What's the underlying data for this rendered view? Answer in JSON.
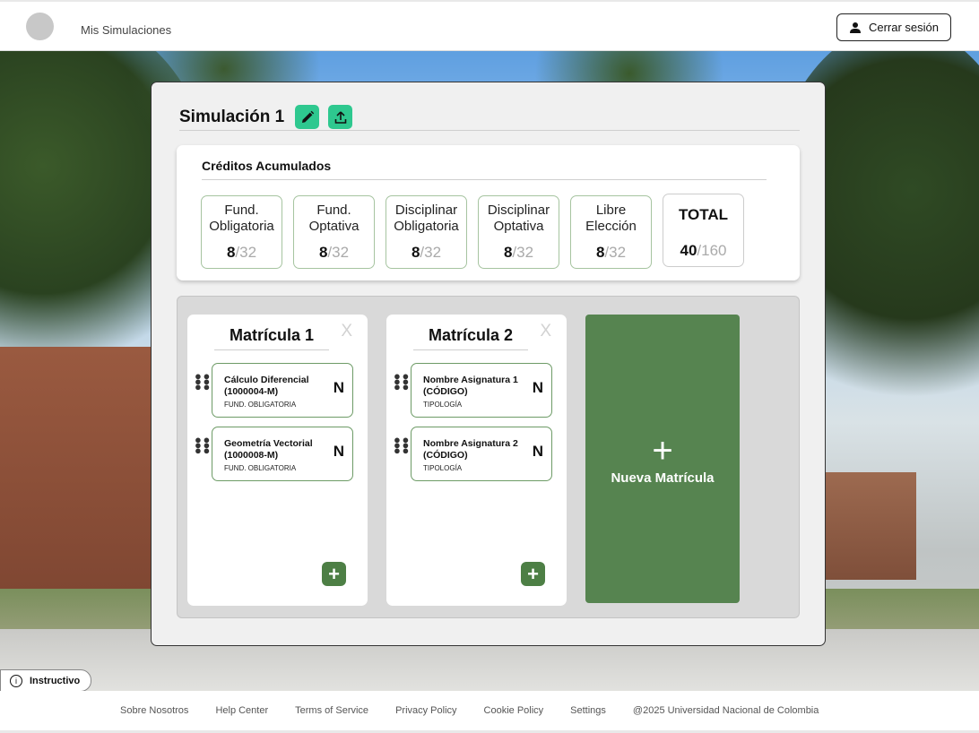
{
  "header": {
    "brand": "Mis Simulaciones",
    "logout_label": "Cerrar sesión"
  },
  "simulation": {
    "title": "Simulación 1"
  },
  "credits": {
    "title": "Créditos Acumulados",
    "cards": [
      {
        "label_line1": "Fund.",
        "label_line2": "Obligatoria",
        "earned": "8",
        "required": "/32"
      },
      {
        "label_line1": "Fund.",
        "label_line2": "Optativa",
        "earned": "8",
        "required": "/32"
      },
      {
        "label_line1": "Disciplinar",
        "label_line2": "Obligatoria",
        "earned": "8",
        "required": "/32"
      },
      {
        "label_line1": "Disciplinar",
        "label_line2": "Optativa",
        "earned": "8",
        "required": "/32"
      },
      {
        "label_line1": "Libre",
        "label_line2": "Elección",
        "earned": "8",
        "required": "/32"
      }
    ],
    "total": {
      "label": "TOTAL",
      "earned": "40",
      "required": "/160"
    }
  },
  "matriculas": [
    {
      "title": "Matrícula 1",
      "close": "X",
      "subjects": [
        {
          "name": "Cálculo Diferencial (1000004-M)",
          "type": "FUND. OBLIGATORIA",
          "grade": "N"
        },
        {
          "name": "Geometría Vectorial (1000008-M)",
          "type": "FUND. OBLIGATORIA",
          "grade": "N"
        }
      ],
      "add": "+"
    },
    {
      "title": "Matrícula 2",
      "close": "X",
      "subjects": [
        {
          "name": "Nombre Asignatura 1 (CÓDIGO)",
          "type": "TIPOLOGÍA",
          "grade": "N"
        },
        {
          "name": "Nombre Asignatura 2 (CÓDIGO)",
          "type": "TIPOLOGÍA",
          "grade": "N"
        }
      ],
      "add": "+"
    }
  ],
  "new_matricula": {
    "plus": "+",
    "label": "Nueva Matrícula"
  },
  "instructivo": {
    "label": "Instructivo",
    "icon": "i"
  },
  "footer": {
    "links": [
      "Sobre Nosotros",
      "Help Center",
      "Terms of Service",
      "Privacy Policy",
      "Cookie Policy",
      "Settings"
    ],
    "copyright": "@2025 Universidad Nacional de Colombia"
  },
  "colors": {
    "accent_teal": "#2ec88f",
    "accent_green": "#568450",
    "dark_green": "#4d7f45"
  }
}
